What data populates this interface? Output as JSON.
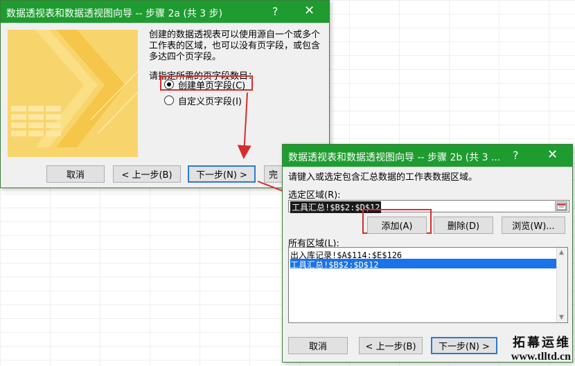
{
  "dialog1": {
    "title": "数据透视表和数据透视图向导 -- 步骤 2a (共 3 步)",
    "help_glyph": "?",
    "close_glyph": "✕",
    "description": "创建的数据透视表可以使用源自一个或多个工作表的区域，也可以没有页字段，或包含多达四个页字段。",
    "prompt": "请指定所需的页字段数目：",
    "options": [
      {
        "label": "创建单页字段(C)",
        "selected": true
      },
      {
        "label": "自定义页字段(I)",
        "selected": false
      }
    ],
    "buttons": {
      "cancel": "取消",
      "back": "< 上一步(B)",
      "next": "下一步(N) >",
      "finish": "完"
    }
  },
  "dialog2": {
    "title": "数据透视表和数据透视图向导 -- 步骤 2b (共 3 ...",
    "help_glyph": "?",
    "close_glyph": "✕",
    "instruction": "请键入或选定包含汇总数据的工作表数据区域。",
    "range_label": "选定区域(R):",
    "range_value": "工具汇总!$B$2:$D$12",
    "buttons_mid": {
      "add": "添加(A)",
      "delete": "删除(D)",
      "browse": "浏览(W)..."
    },
    "all_ranges_label": "所有区域(L):",
    "all_ranges": [
      {
        "text": "出入库记录!$A$114:$E$126",
        "selected": false
      },
      {
        "text": "工具汇总!$B$2:$D$12",
        "selected": true
      }
    ],
    "buttons": {
      "cancel": "取消",
      "back": "< 上一步(B)",
      "next": "下一步(N) >"
    }
  },
  "watermark": {
    "line1": "拓幕运维",
    "line2": "www.tlltd.cn"
  },
  "colors": {
    "titlebar": "#1e9c30",
    "highlight_box": "#d62c2c",
    "selection": "#1a73e8"
  }
}
